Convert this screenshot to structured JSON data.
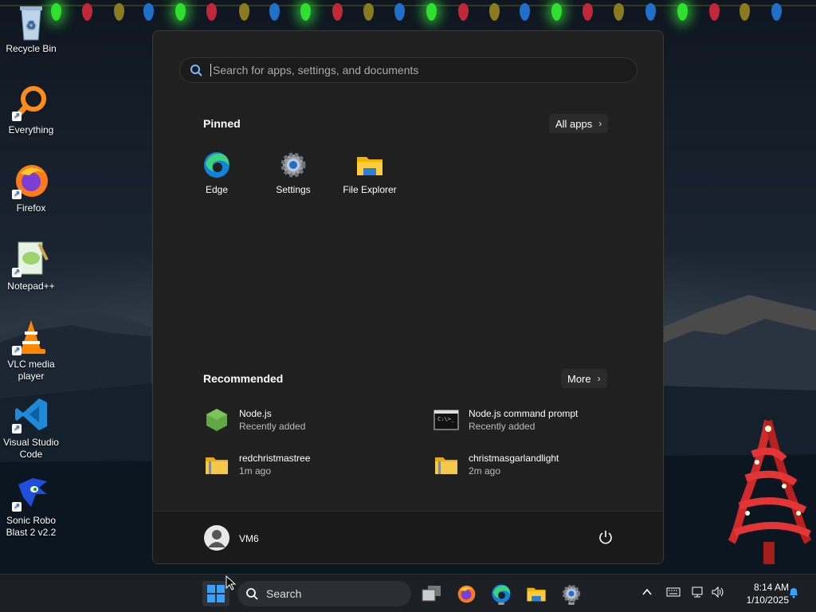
{
  "desktop": {
    "icons": [
      {
        "label": "Recycle Bin",
        "icon": "recycle-bin-icon"
      },
      {
        "label": "Everything",
        "icon": "everything-search-icon"
      },
      {
        "label": "Firefox",
        "icon": "firefox-icon"
      },
      {
        "label": "Notepad++",
        "icon": "notepad-plus-plus-icon"
      },
      {
        "label": "VLC media player",
        "icon": "vlc-cone-icon"
      },
      {
        "label": "Visual Studio Code",
        "icon": "vscode-icon"
      },
      {
        "label": "Sonic Robo Blast 2 v2.2",
        "icon": "sonic-icon"
      }
    ]
  },
  "start_menu": {
    "search_placeholder": "Search for apps, settings, and documents",
    "pinned_title": "Pinned",
    "all_apps_label": "All apps",
    "pinned": [
      {
        "label": "Edge",
        "icon": "edge-icon"
      },
      {
        "label": "Settings",
        "icon": "gear-icon"
      },
      {
        "label": "File Explorer",
        "icon": "folder-icon"
      }
    ],
    "recommended_title": "Recommended",
    "more_label": "More",
    "recommended": [
      {
        "name": "Node.js",
        "sub": "Recently added",
        "icon": "nodejs-icon"
      },
      {
        "name": "Node.js command prompt",
        "sub": "Recently added",
        "icon": "command-prompt-icon"
      },
      {
        "name": "redchristmastree",
        "sub": "1m ago",
        "icon": "zip-folder-icon"
      },
      {
        "name": "christmasgarlandlight",
        "sub": "2m ago",
        "icon": "zip-folder-icon"
      }
    ],
    "user_name": "VM6"
  },
  "taskbar": {
    "search_label": "Search",
    "clock_time": "8:14 AM",
    "clock_date": "1/10/2025"
  },
  "colors": {
    "accent": "#0078d4",
    "menu_bg": "#202020",
    "taskbar_bg": "#1c1f24"
  }
}
